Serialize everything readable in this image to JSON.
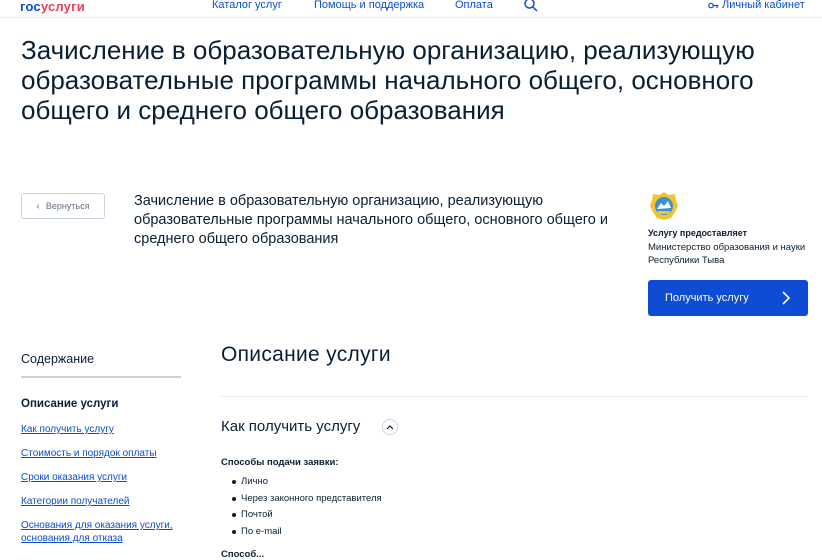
{
  "header": {
    "logo_part1": "гос",
    "logo_part2": "услуги",
    "nav": [
      "Каталог услуг",
      "Помощь и поддержка",
      "Оплата"
    ],
    "cabinet_label": "Личный кабинет"
  },
  "page_title": "Зачисление в образовательную организацию, реализующую образовательные программы начального общего, основного общего и среднего общего образования",
  "back_label": "Вернуться",
  "service_name": "Зачисление в образовательную организацию, реализующую образовательные программы начального общего, основного общего и среднего общего образования",
  "provider": {
    "label": "Услугу предоставляет",
    "name": "Министерство образования и науки Республики Тыва"
  },
  "get_service_label": "Получить услугу",
  "sidebar": {
    "title": "Содержание",
    "active": "Описание услуги",
    "links": [
      "Как получить услугу",
      "Стоимость и порядок оплаты",
      "Сроки оказания услуги",
      "Категории получателей",
      "Основания для оказания услуги, основания для отказа"
    ]
  },
  "main": {
    "section_title": "Описание услуги",
    "subsection_title": "Как получить услугу",
    "ways_label": "Способы подачи заявки:",
    "ways": [
      "Лично",
      "Через законного представителя",
      "Почтой",
      "По e-mail"
    ],
    "cut_text": "Способ..."
  },
  "colors": {
    "brand_blue": "#0d4cd3",
    "brand_red": "#ee3f58",
    "text": "#0b1f33"
  }
}
